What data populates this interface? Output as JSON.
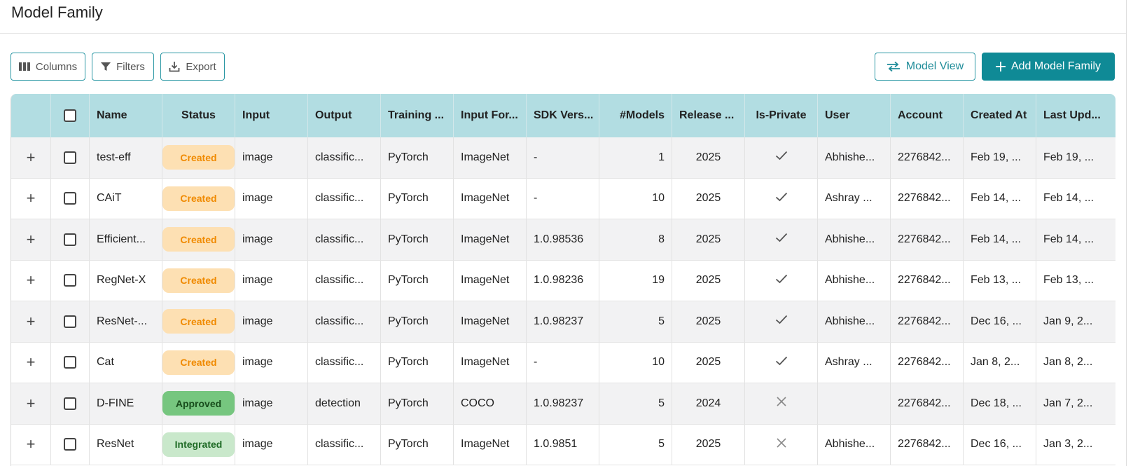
{
  "page": {
    "title": "Model Family"
  },
  "toolbar": {
    "columns_label": "Columns",
    "filters_label": "Filters",
    "export_label": "Export",
    "model_view_label": "Model View",
    "add_label": "Add Model Family"
  },
  "table": {
    "headers": {
      "name": "Name",
      "status": "Status",
      "input": "Input",
      "output": "Output",
      "training": "Training ...",
      "input_format": "Input For...",
      "sdk": "SDK Vers...",
      "models": "#Models",
      "release": "Release ...",
      "private": "Is-Private",
      "user": "User",
      "account": "Account",
      "created": "Created At",
      "updated": "Last Upd..."
    },
    "rows": [
      {
        "name": "test-eff",
        "status": "Created",
        "status_kind": "created",
        "input": "image",
        "output": "classific...",
        "training": "PyTorch",
        "input_format": "ImageNet",
        "sdk": "-",
        "models": "1",
        "release": "2025",
        "private": true,
        "user": "Abhishe...",
        "account": "2276842...",
        "created": "Feb 19, ...",
        "updated": "Feb 19, ..."
      },
      {
        "name": "CAiT",
        "status": "Created",
        "status_kind": "created",
        "input": "image",
        "output": "classific...",
        "training": "PyTorch",
        "input_format": "ImageNet",
        "sdk": "-",
        "models": "10",
        "release": "2025",
        "private": true,
        "user": "Ashray ...",
        "account": "2276842...",
        "created": "Feb 14, ...",
        "updated": "Feb 14, ..."
      },
      {
        "name": "Efficient...",
        "status": "Created",
        "status_kind": "created",
        "input": "image",
        "output": "classific...",
        "training": "PyTorch",
        "input_format": "ImageNet",
        "sdk": "1.0.98536",
        "models": "8",
        "release": "2025",
        "private": true,
        "user": "Abhishe...",
        "account": "2276842...",
        "created": "Feb 14, ...",
        "updated": "Feb 14, ..."
      },
      {
        "name": "RegNet-X",
        "status": "Created",
        "status_kind": "created",
        "input": "image",
        "output": "classific...",
        "training": "PyTorch",
        "input_format": "ImageNet",
        "sdk": "1.0.98236",
        "models": "19",
        "release": "2025",
        "private": true,
        "user": "Abhishe...",
        "account": "2276842...",
        "created": "Feb 13, ...",
        "updated": "Feb 13, ..."
      },
      {
        "name": "ResNet-...",
        "status": "Created",
        "status_kind": "created",
        "input": "image",
        "output": "classific...",
        "training": "PyTorch",
        "input_format": "ImageNet",
        "sdk": "1.0.98237",
        "models": "5",
        "release": "2025",
        "private": true,
        "user": "Abhishe...",
        "account": "2276842...",
        "created": "Dec 16, ...",
        "updated": "Jan 9, 2..."
      },
      {
        "name": "Cat",
        "status": "Created",
        "status_kind": "created",
        "input": "image",
        "output": "classific...",
        "training": "PyTorch",
        "input_format": "ImageNet",
        "sdk": "-",
        "models": "10",
        "release": "2025",
        "private": true,
        "user": "Ashray ...",
        "account": "2276842...",
        "created": "Jan 8, 2...",
        "updated": "Jan 8, 2..."
      },
      {
        "name": "D-FINE",
        "status": "Approved",
        "status_kind": "approved",
        "input": "image",
        "output": "detection",
        "training": "PyTorch",
        "input_format": "COCO",
        "sdk": "1.0.98237",
        "models": "5",
        "release": "2024",
        "private": false,
        "user": "",
        "account": "2276842...",
        "created": "Dec 18, ...",
        "updated": "Jan 7, 2..."
      },
      {
        "name": "ResNet",
        "status": "Integrated",
        "status_kind": "integrated",
        "input": "image",
        "output": "classific...",
        "training": "PyTorch",
        "input_format": "ImageNet",
        "sdk": "1.0.9851",
        "models": "5",
        "release": "2025",
        "private": false,
        "user": "Abhishe...",
        "account": "2276842...",
        "created": "Dec 16, ...",
        "updated": "Jan 3, 2..."
      }
    ]
  },
  "colors": {
    "header_bg": "#b2dde2",
    "accent": "#0f8a96",
    "created_badge": "#fde0b3",
    "approved_badge": "#76c67f",
    "integrated_badge": "#c9e8cb"
  },
  "icons": {
    "columns": "columns-icon",
    "filters": "filter-icon",
    "export": "export-icon",
    "model_view": "swap-icon",
    "add": "plus-icon",
    "expand": "plus-icon",
    "private_true": "checkmark-icon",
    "private_false": "x-icon"
  }
}
